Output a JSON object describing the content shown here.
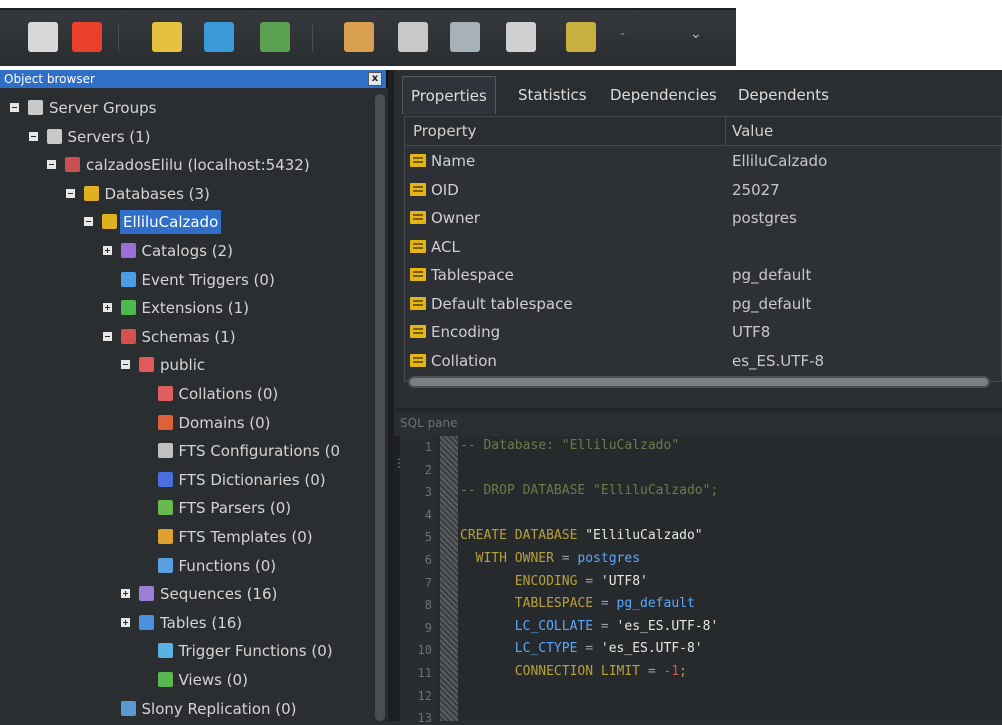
{
  "object_browser": {
    "title": "Object browser",
    "close_label": "x",
    "tree": [
      {
        "label": "Server Groups",
        "expander": "minus",
        "icon": "server-groups-icon",
        "icon_color": "#c9c9c9"
      },
      {
        "label": "Servers (1)",
        "expander": "minus",
        "icon": "servers-icon",
        "icon_color": "#c9c9c9"
      },
      {
        "label": "calzadosElilu (localhost:5432)",
        "expander": "minus",
        "icon": "server-icon",
        "icon_color": "#c95050"
      },
      {
        "label": "Databases (3)",
        "expander": "minus",
        "icon": "databases-icon",
        "icon_color": "#e0b020"
      },
      {
        "label": "ElliluCalzado",
        "expander": "minus",
        "icon": "database-icon",
        "icon_color": "#e0b020",
        "selected": true
      },
      {
        "label": "Catalogs (2)",
        "expander": "plus",
        "icon": "catalogs-icon",
        "icon_color": "#9b6fd6"
      },
      {
        "label": "Event Triggers (0)",
        "expander": "",
        "icon": "event-triggers-icon",
        "icon_color": "#4aa0e6"
      },
      {
        "label": "Extensions (1)",
        "expander": "plus",
        "icon": "extensions-icon",
        "icon_color": "#4fb850"
      },
      {
        "label": "Schemas (1)",
        "expander": "minus",
        "icon": "schemas-icon",
        "icon_color": "#d65050"
      },
      {
        "label": "public",
        "expander": "minus",
        "icon": "public-schema-icon",
        "icon_color": "#e05a5a"
      },
      {
        "label": "Collations (0)",
        "expander": "",
        "icon": "collations-icon",
        "icon_color": "#e06060"
      },
      {
        "label": "Domains (0)",
        "expander": "",
        "icon": "domains-icon",
        "icon_color": "#e0603a"
      },
      {
        "label": "FTS Configurations (0",
        "expander": "",
        "icon": "fts-configurations-icon",
        "icon_color": "#c0c0c0"
      },
      {
        "label": "FTS Dictionaries (0)",
        "expander": "",
        "icon": "fts-dictionaries-icon",
        "icon_color": "#4a70e0"
      },
      {
        "label": "FTS Parsers (0)",
        "expander": "",
        "icon": "fts-parsers-icon",
        "icon_color": "#6ab850"
      },
      {
        "label": "FTS Templates (0)",
        "expander": "",
        "icon": "fts-templates-icon",
        "icon_color": "#e0a030"
      },
      {
        "label": "Functions (0)",
        "expander": "",
        "icon": "functions-icon",
        "icon_color": "#5aa0e0"
      },
      {
        "label": "Sequences (16)",
        "expander": "plus",
        "icon": "sequences-icon",
        "icon_color": "#9b7fd6"
      },
      {
        "label": "Tables (16)",
        "expander": "plus",
        "icon": "tables-icon",
        "icon_color": "#4a90e0"
      },
      {
        "label": "Trigger Functions (0)",
        "expander": "",
        "icon": "trigger-functions-icon",
        "icon_color": "#5ab0e0"
      },
      {
        "label": "Views (0)",
        "expander": "",
        "icon": "views-icon",
        "icon_color": "#5ab850"
      },
      {
        "label": "Slony Replication (0)",
        "expander": "",
        "icon": "slony-replication-icon",
        "icon_color": "#5a9ad0"
      }
    ]
  },
  "properties": {
    "tabs": [
      "Properties",
      "Statistics",
      "Dependencies",
      "Dependents"
    ],
    "active_tab": "Properties",
    "column_property": "Property",
    "column_value": "Value",
    "rows": [
      {
        "name": "Name",
        "value": "ElliluCalzado"
      },
      {
        "name": "OID",
        "value": "25027"
      },
      {
        "name": "Owner",
        "value": "postgres"
      },
      {
        "name": "ACL",
        "value": ""
      },
      {
        "name": "Tablespace",
        "value": "pg_default"
      },
      {
        "name": "Default tablespace",
        "value": "pg_default"
      },
      {
        "name": "Encoding",
        "value": "UTF8"
      },
      {
        "name": "Collation",
        "value": "es_ES.UTF-8"
      }
    ]
  },
  "sql_pane": {
    "title": "SQL pane",
    "lines": [
      {
        "n": "1",
        "parts": [
          {
            "t": "-- Database: \"ElliluCalzado\"",
            "c": "comment"
          }
        ]
      },
      {
        "n": "2",
        "parts": []
      },
      {
        "n": "3",
        "parts": [
          {
            "t": "-- DROP DATABASE \"ElliluCalzado\";",
            "c": "comment"
          }
        ]
      },
      {
        "n": "4",
        "parts": []
      },
      {
        "n": "5",
        "parts": [
          {
            "t": "CREATE DATABASE ",
            "c": "kw"
          },
          {
            "t": "\"ElliluCalzado\"",
            "c": "str"
          }
        ]
      },
      {
        "n": "6",
        "parts": [
          {
            "t": "  WITH OWNER ",
            "c": "kw"
          },
          {
            "t": "= ",
            "c": "op"
          },
          {
            "t": "postgres",
            "c": "id"
          }
        ]
      },
      {
        "n": "7",
        "parts": [
          {
            "t": "       ENCODING ",
            "c": "kw"
          },
          {
            "t": "= ",
            "c": "op"
          },
          {
            "t": "'UTF8'",
            "c": "str"
          }
        ]
      },
      {
        "n": "8",
        "parts": [
          {
            "t": "       TABLESPACE ",
            "c": "kw"
          },
          {
            "t": "= ",
            "c": "op"
          },
          {
            "t": "pg_default",
            "c": "id"
          }
        ]
      },
      {
        "n": "9",
        "parts": [
          {
            "t": "       LC_COLLATE ",
            "c": "id"
          },
          {
            "t": "= ",
            "c": "op"
          },
          {
            "t": "'es_ES.UTF-8'",
            "c": "str"
          }
        ]
      },
      {
        "n": "10",
        "parts": [
          {
            "t": "       LC_CTYPE ",
            "c": "id"
          },
          {
            "t": "= ",
            "c": "op"
          },
          {
            "t": "'es_ES.UTF-8'",
            "c": "str"
          }
        ]
      },
      {
        "n": "11",
        "parts": [
          {
            "t": "       CONNECTION LIMIT ",
            "c": "kw"
          },
          {
            "t": "= ",
            "c": "op"
          },
          {
            "t": "-1",
            "c": "num"
          },
          {
            "t": ";",
            "c": "kw"
          }
        ]
      },
      {
        "n": "12",
        "parts": []
      },
      {
        "n": "13",
        "parts": []
      }
    ]
  },
  "toolbar": {
    "buttons": [
      {
        "name": "connect-plug-icon",
        "color": "#d8d8d8"
      },
      {
        "name": "refresh-icon",
        "color": "#e8402a"
      },
      {
        "name": "properties-folder-icon",
        "color": "#e8c040"
      },
      {
        "name": "create-object-icon",
        "color": "#3a9ad8"
      },
      {
        "name": "drop-object-icon",
        "color": "#5aa050"
      },
      {
        "name": "sql-query-icon",
        "color": "#d8a050"
      },
      {
        "name": "view-data-icon",
        "color": "#c8c8c8"
      },
      {
        "name": "filtered-data-icon",
        "color": "#a8b0b8"
      },
      {
        "name": "maintenance-wrench-icon",
        "color": "#d0d0d0"
      },
      {
        "name": "plugins-icon",
        "color": "#c8b040"
      }
    ],
    "more": "⌄",
    "dropdown": "-"
  }
}
